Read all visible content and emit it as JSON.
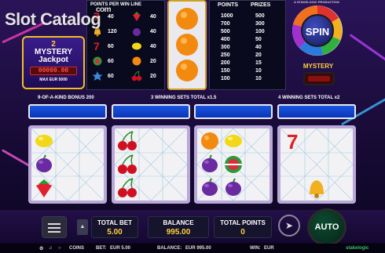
{
  "watermark": {
    "text": "Slot Catalog",
    "sup": "com"
  },
  "logo": {
    "number": "2",
    "line1": "MYSTERY",
    "line2": "Jackpot",
    "digits": "00000.00",
    "max_win": "MAX EUR 5000"
  },
  "paytable": {
    "header": "POINTS PER WIN LINE",
    "left_values": [
      "40",
      "120",
      "60",
      "60",
      "60"
    ],
    "right_values": [
      "40",
      "40",
      "40",
      "20",
      "20"
    ]
  },
  "prizes": {
    "points_header": "POINTS",
    "prizes_header": "PRIZES",
    "rows": [
      [
        "1000",
        "500"
      ],
      [
        "700",
        "300"
      ],
      [
        "500",
        "100"
      ],
      [
        "400",
        "50"
      ],
      [
        "300",
        "40"
      ],
      [
        "250",
        "20"
      ],
      [
        "200",
        "15"
      ],
      [
        "150",
        "10"
      ],
      [
        "100",
        "10"
      ]
    ]
  },
  "producer": "A STAKELOGIC PRODUCTION",
  "spin": {
    "label": "SPIN"
  },
  "mystery": {
    "label": "MYSTERY"
  },
  "bonus_labels": [
    "9-OF-A-KIND BONUS 200",
    "3 WINNING SETS TOTAL x1.5",
    "4 WINNING SETS TOTAL x2"
  ],
  "panels": [
    {
      "cells": [
        "lemon",
        "",
        "",
        "plum",
        "",
        "",
        "strawberry",
        "",
        ""
      ]
    },
    {
      "cells": [
        "cherry",
        "",
        "",
        "cherry",
        "",
        "",
        "cherry",
        "",
        ""
      ]
    },
    {
      "cells": [
        "orange",
        "lemon",
        "",
        "plum",
        "watermelon",
        "",
        "plum",
        "plum",
        ""
      ]
    },
    {
      "cells": [
        "seven",
        "",
        "",
        "",
        "",
        "",
        "",
        "bell",
        ""
      ]
    }
  ],
  "footer": {
    "total_bet_label": "TOTAL BET",
    "total_bet": "5.00",
    "balance_label": "BALANCE",
    "balance": "995.00",
    "total_points_label": "TOTAL POINTS",
    "total_points": "0",
    "auto_label": "AUTO"
  },
  "status": {
    "coins": "COINS",
    "bet_label": "BET:",
    "bet_value": "EUR 5.00",
    "balance_label": "BALANCE:",
    "balance_value": "EUR 995.00",
    "win_label": "WIN:",
    "win_value": "EUR",
    "brand": "stakelogic"
  },
  "colors": {
    "bar_blue": "#1a55e0",
    "gold": "#ffd040",
    "spin_blue": "#2a38a8",
    "auto_green": "#0d4a30"
  }
}
